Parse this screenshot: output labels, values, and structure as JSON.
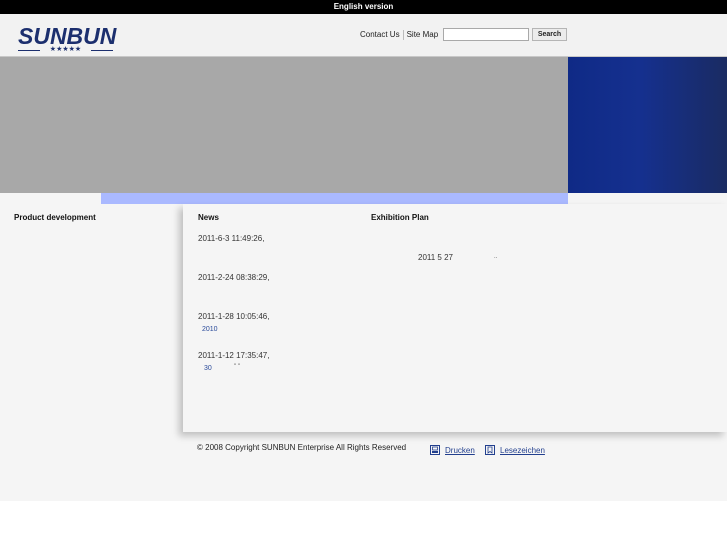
{
  "topbar": {
    "language_link": "English version"
  },
  "logo": {
    "text": "SUNBUN",
    "stars": "★★★★★"
  },
  "header": {
    "contact_us": "Contact Us",
    "site_map": "Site Map",
    "search_value": "",
    "search_button": "Search"
  },
  "sections": {
    "product_development": "Product development",
    "news": "News",
    "exhibition_plan": "Exhibition Plan"
  },
  "news_items": [
    {
      "date": "2011-6-3 11:49:26,",
      "link": ""
    },
    {
      "date": "2011-2-24 08:38:29,",
      "link": ""
    },
    {
      "date": "2011-1-28 10:05:46,",
      "link": "2010"
    },
    {
      "date": "2011-1-12 17:35:47,",
      "link": "30",
      "marks": "\"   \""
    }
  ],
  "exhibition": {
    "date_text": "2011 5 27",
    "trail": ".."
  },
  "footer": {
    "copyright": "© 2008 Copyright SUNBUN Enterprise All Rights Reserved",
    "print_link": "Drucken",
    "bookmark_link": "Lesezeichen"
  },
  "colors": {
    "topbar": "#000000",
    "brand_navy": "#1c2f6e",
    "banner_gray": "#a8a8a8",
    "banner_blue": "#0f2a86",
    "link_blue": "#223f8e"
  },
  "icons": {
    "print": "print-icon",
    "bookmark": "bookmark-icon"
  }
}
